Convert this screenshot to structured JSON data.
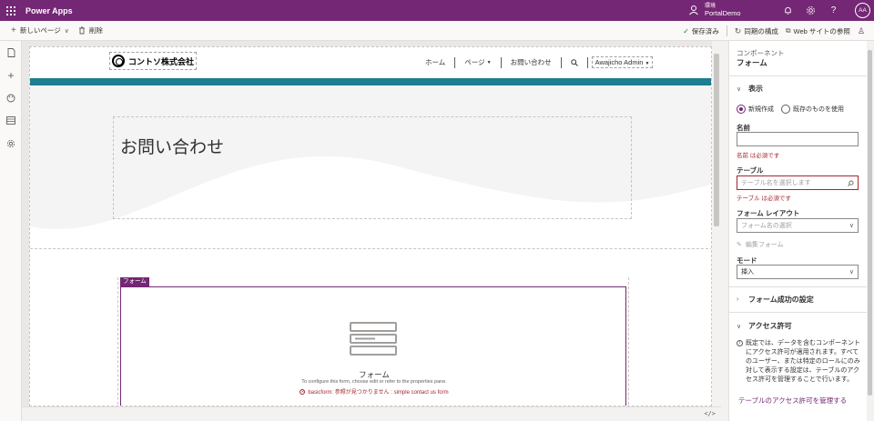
{
  "topbar": {
    "app_title": "Power Apps",
    "env_label": "環境",
    "env_name": "PortalDemo",
    "avatar_initials": "AA"
  },
  "cmdbar": {
    "new_page": "新しいページ",
    "delete": "削除",
    "saved": "保存済み",
    "sync": "同期の構成",
    "browse": "Web サイトの参照"
  },
  "site": {
    "logo_text": "コントソ株式会社",
    "nav": [
      "ホーム",
      "ページ",
      "お問い合わせ"
    ],
    "admin_user": "Awajicho Admin",
    "hero_title": "お問い合わせ"
  },
  "form_component": {
    "tag": "フォーム",
    "label": "フォーム",
    "hint": "To configure this form, choose edit or refer to the properties pane.",
    "error": "basicform: 参照が見つかりません : simple contact us form"
  },
  "panel": {
    "kicker": "コンポーネント",
    "title": "フォーム",
    "section_display": "表示",
    "radio_new": "新規作成",
    "radio_existing": "既存のものを使用",
    "name_label": "名前",
    "name_value": "",
    "name_error": "名前 は必須です",
    "table_label": "テーブル",
    "table_placeholder": "テーブル名を選択します",
    "table_error": "テーブル は必須です",
    "layout_label": "フォーム レイアウト",
    "layout_placeholder": "フォーム名の選択",
    "edit_form": "編集フォーム",
    "mode_label": "モード",
    "mode_value": "挿入",
    "section_success": "フォーム成功の設定",
    "section_access": "アクセス許可",
    "access_info": "既定では、データを含むコンポーネントにアクセス許可が適用されます。すべてのユーザー、または特定のロールにのみ対して表示する設定は、テーブルのアクセス許可を管理することで行います。",
    "manage_link": "テーブルのアクセス許可を管理する"
  },
  "colors": {
    "brand": "#742774",
    "teal": "#1e7d91",
    "error": "#a4262c"
  }
}
